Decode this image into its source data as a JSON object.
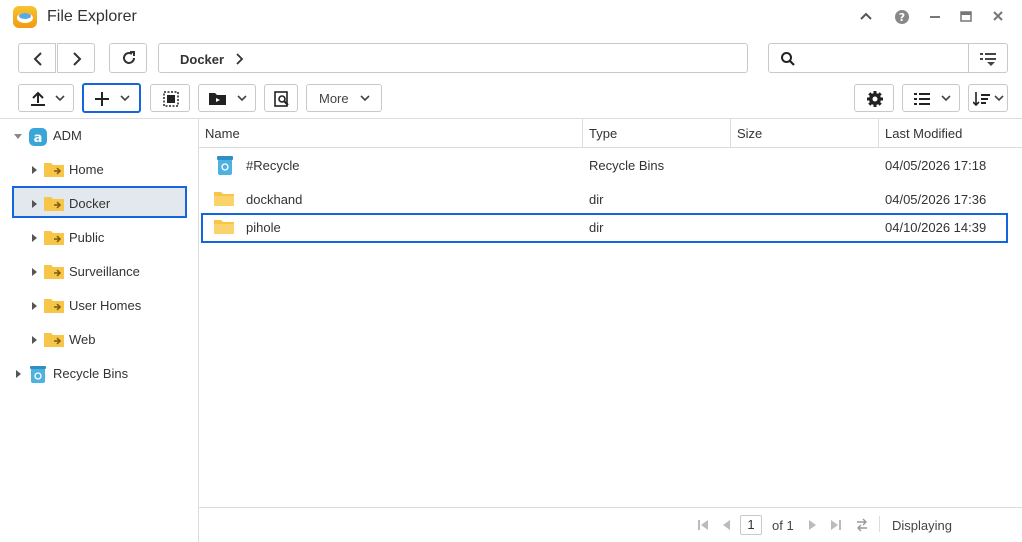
{
  "app": {
    "title": "File Explorer"
  },
  "nav": {
    "breadcrumb": "Docker"
  },
  "search": {
    "placeholder": ""
  },
  "toolbar": {
    "more_label": "More"
  },
  "tree": {
    "root": "ADM",
    "items": [
      "Home",
      "Docker",
      "Public",
      "Surveillance",
      "User Homes",
      "Web"
    ],
    "recycle": "Recycle Bins",
    "selected": "Docker"
  },
  "list": {
    "columns": [
      "Name",
      "Type",
      "Size",
      "Last Modified"
    ],
    "rows": [
      {
        "name": "#Recycle",
        "type": "Recycle Bins",
        "size": "",
        "modified": "04/05/2026 17:18"
      },
      {
        "name": "dockhand",
        "type": "dir",
        "size": "",
        "modified": "04/05/2026 17:36"
      },
      {
        "name": "pihole",
        "type": "dir",
        "size": "",
        "modified": "04/10/2026 14:39"
      }
    ]
  },
  "footer": {
    "page": "1",
    "of_label": "of 1",
    "status": "Displaying"
  },
  "colors": {
    "accent": "#1565e0",
    "folder": "#f7c548",
    "selection": "#e3e7ee"
  }
}
